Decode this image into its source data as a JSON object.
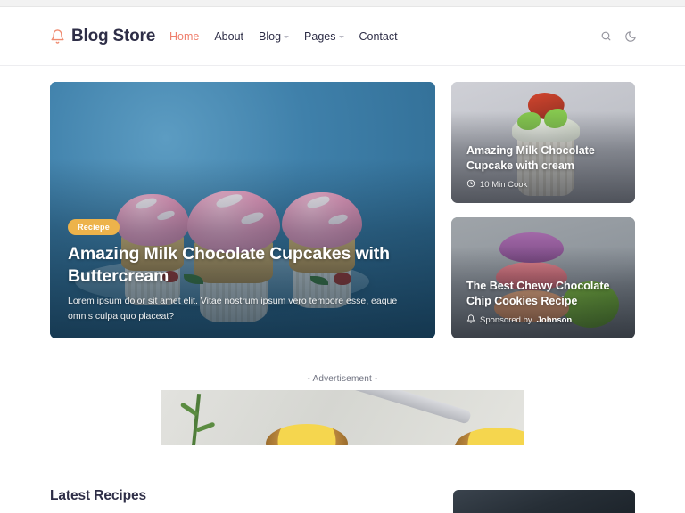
{
  "header": {
    "brand": {
      "icon": "bell-icon",
      "text": "Blog Store"
    },
    "nav": [
      {
        "label": "Home",
        "active": true,
        "caret": false
      },
      {
        "label": "About",
        "active": false,
        "caret": false
      },
      {
        "label": "Blog",
        "active": false,
        "caret": true
      },
      {
        "label": "Pages",
        "active": false,
        "caret": true
      },
      {
        "label": "Contact",
        "active": false,
        "caret": false
      }
    ],
    "actions": [
      {
        "icon": "search-icon"
      },
      {
        "icon": "moon-icon"
      }
    ]
  },
  "hero": {
    "badge": "Reciepe",
    "title": "Amazing Milk Chocolate Cupcakes with Buttercream",
    "excerpt": "Lorem ipsum dolor sit amet elit. Vitae nostrum ipsum vero tempore esse, eaque omnis culpa quo placeat?"
  },
  "side_cards": [
    {
      "title": "Amazing Milk Chocolate Cupcake with cream",
      "meta_icon": "clock-icon",
      "meta_text": "10 Min Cook"
    },
    {
      "title": "The Best Chewy Chocolate Chip Cookies Recipe",
      "meta_icon": "bell-icon",
      "meta_prefix": "Sponsored by",
      "meta_sponsor": "Johnson"
    }
  ],
  "advertisement": {
    "label": "- Advertisement -"
  },
  "latest": {
    "title": "Latest Recipes"
  },
  "colors": {
    "accent": "#ef7f6d",
    "badge": "#edb34b",
    "text_dark": "#2e2e47",
    "hero_bg": "#3d7ca6"
  }
}
